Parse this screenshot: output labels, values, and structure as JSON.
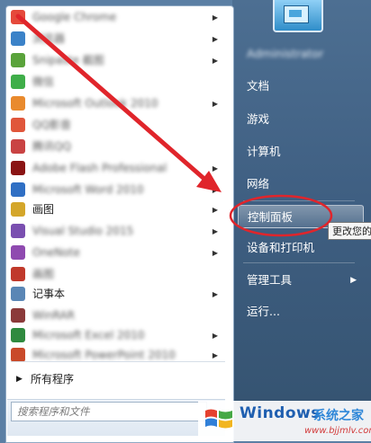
{
  "left_programs": [
    {
      "label": "Google Chrome",
      "blurred": true,
      "arrow": true,
      "color": "#e5493b"
    },
    {
      "label": "浏览器",
      "blurred": true,
      "arrow": true,
      "color": "#3b82c8"
    },
    {
      "label": "Snipaste 截图",
      "blurred": true,
      "arrow": true,
      "color": "#5aa33b"
    },
    {
      "label": "微信",
      "blurred": true,
      "arrow": false,
      "color": "#3fae49"
    },
    {
      "label": "Microsoft Outlook 2010",
      "blurred": true,
      "arrow": true,
      "color": "#e98a2d"
    },
    {
      "label": "QQ影音",
      "blurred": true,
      "arrow": false,
      "color": "#e0563b"
    },
    {
      "label": "腾讯QQ",
      "blurred": true,
      "arrow": false,
      "color": "#c94343"
    },
    {
      "label": "Adobe Flash Professional",
      "blurred": true,
      "arrow": true,
      "color": "#8a1414"
    },
    {
      "label": "Microsoft Word 2010",
      "blurred": true,
      "arrow": true,
      "color": "#2f6fc4"
    },
    {
      "label": "画图",
      "blurred": false,
      "arrow": true,
      "color": "#d4a62a"
    },
    {
      "label": "Visual Studio 2015",
      "blurred": true,
      "arrow": true,
      "color": "#7a4fb0"
    },
    {
      "label": "OneNote",
      "blurred": true,
      "arrow": true,
      "color": "#8f4ab0"
    },
    {
      "label": "画图",
      "blurred": true,
      "arrow": false,
      "color": "#c0392b"
    },
    {
      "label": "记事本",
      "blurred": false,
      "arrow": true,
      "color": "#5a86b5"
    },
    {
      "label": "WinRAR",
      "blurred": true,
      "arrow": false,
      "color": "#8b3a3a"
    },
    {
      "label": "Microsoft Excel 2010",
      "blurred": true,
      "arrow": true,
      "color": "#2f8a3f"
    },
    {
      "label": "Microsoft PowerPoint 2010",
      "blurred": true,
      "arrow": true,
      "color": "#c94a2a"
    }
  ],
  "all_programs": "所有程序",
  "search": {
    "placeholder": "搜索程序和文件"
  },
  "right_items": {
    "username": "Administrator",
    "documents": "文档",
    "games": "游戏",
    "computer": "计算机",
    "network": "网络",
    "control_panel": "控制面板",
    "devices_printers": "设备和打印机",
    "admin_tools": "管理工具",
    "run": "运行..."
  },
  "tooltip": "更改您的",
  "watermark": {
    "brand": "Windows",
    "brand_cn": "系统之家",
    "url": "www.bjjmlv.com"
  },
  "colors": {
    "annotation_red": "#e0252b",
    "highlight": "#ffffff"
  }
}
